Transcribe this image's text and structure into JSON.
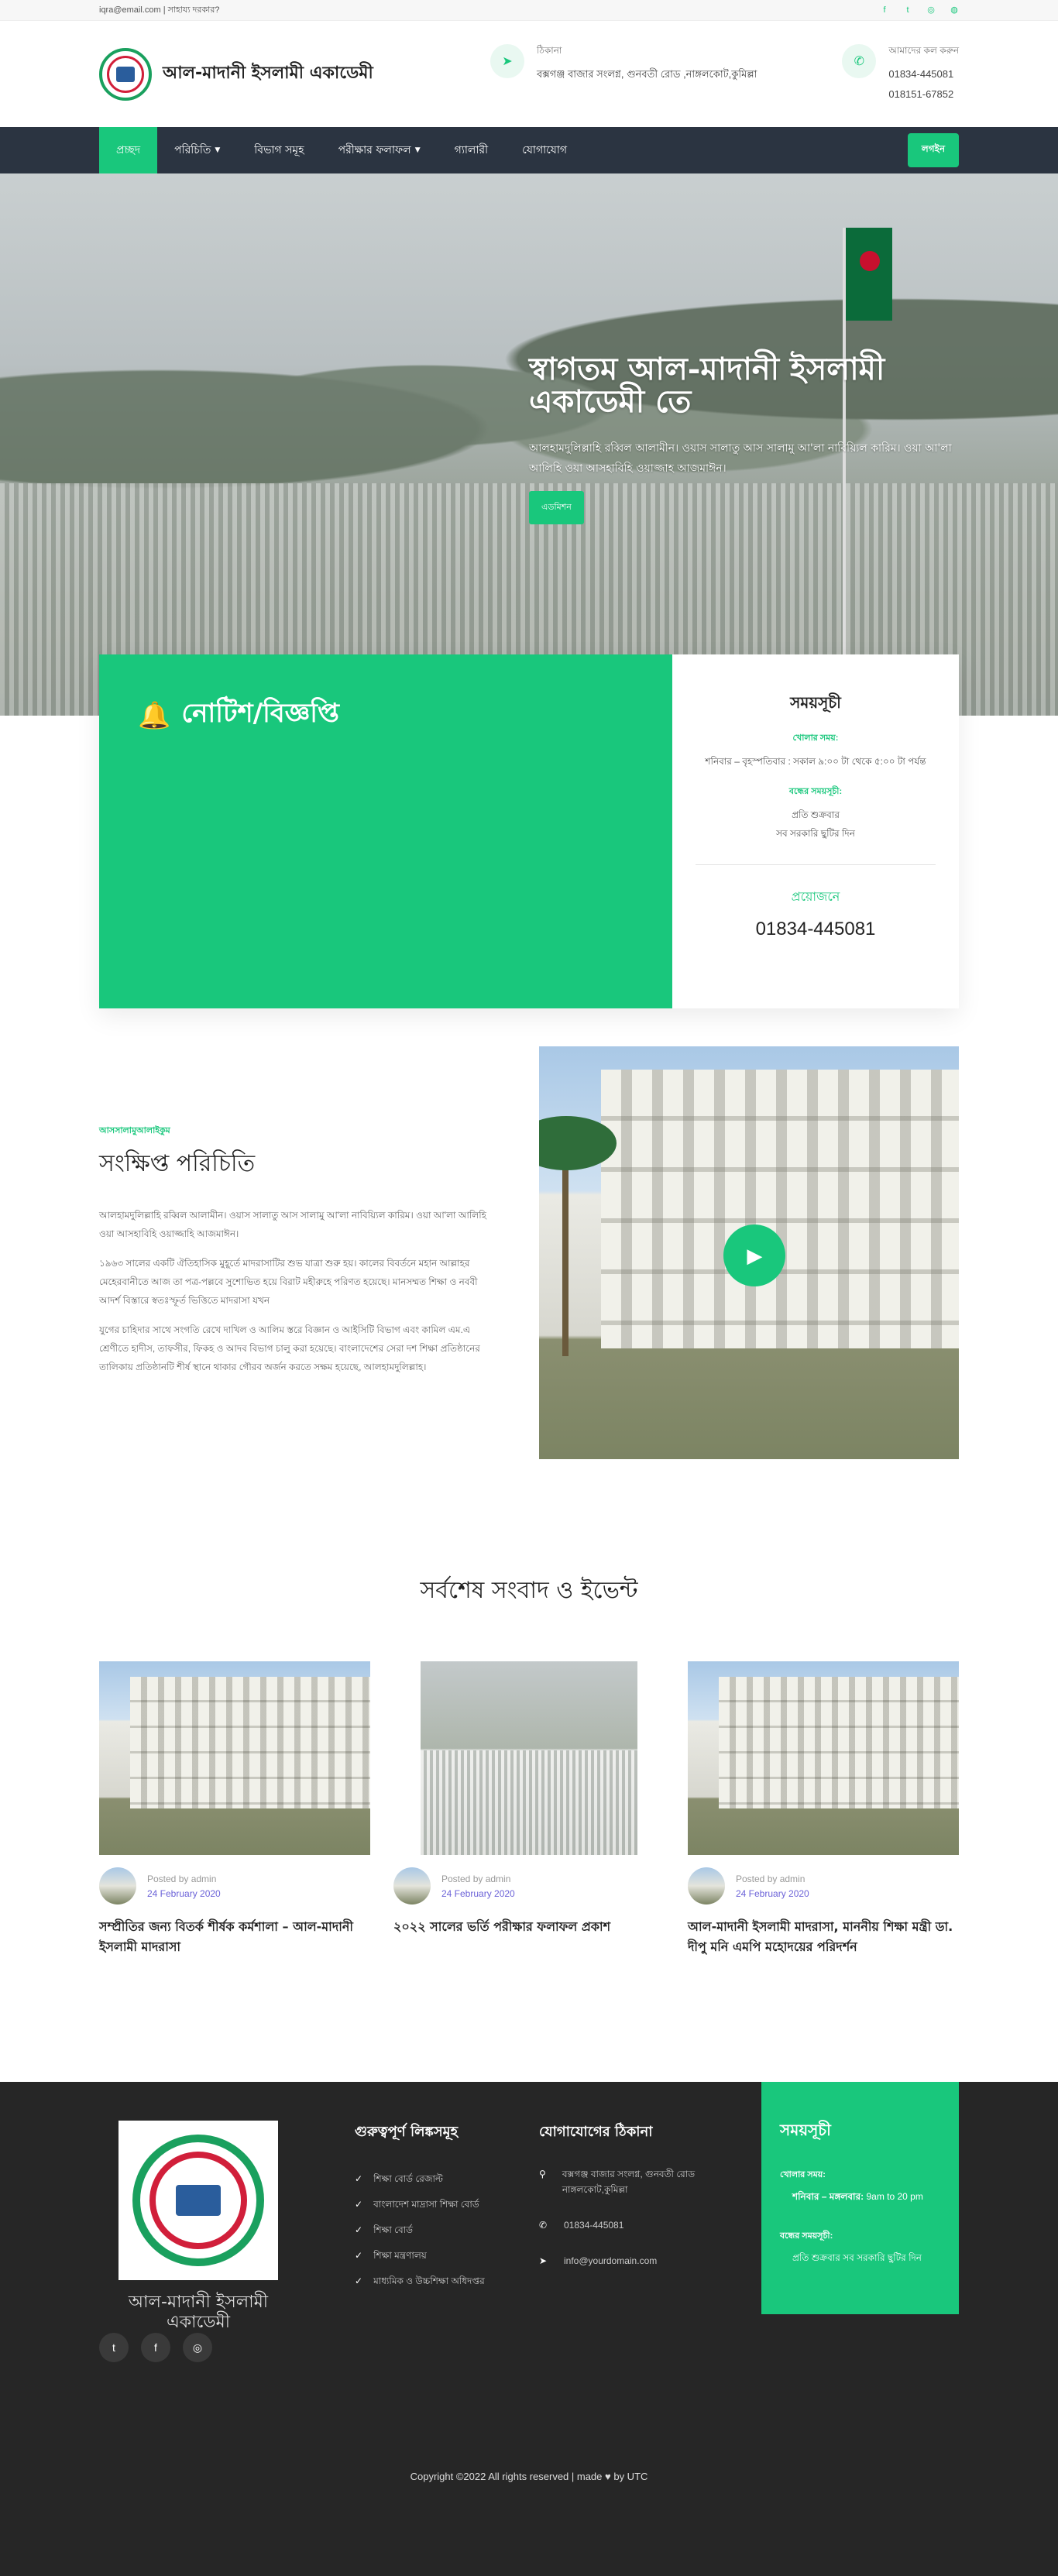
{
  "topbar": {
    "contact_text": "iqra@email.com | সাহায্য দরকার?",
    "social_icons": [
      "facebook-icon",
      "twitter-icon",
      "instagram-icon",
      "dribbble-icon"
    ]
  },
  "header": {
    "brand_name": "আল-মাদানী ইসলামী একাডেমী",
    "address_label": "ঠিকানা",
    "address_value": "বক্সগঞ্জ বাজার সংলগ্ন, গুনবতী রোড ,নাঙ্গলকোট,কুমিল্লা",
    "call_label": "আমাদের কল করুন",
    "call_value_1": "01834-445081",
    "call_value_2": "018151-67852"
  },
  "nav": {
    "items": [
      {
        "label": "প্রচ্ছদ",
        "active": true,
        "dropdown": false
      },
      {
        "label": "পরিচিতি",
        "active": false,
        "dropdown": true
      },
      {
        "label": "বিভাগ সমূহ",
        "active": false,
        "dropdown": false
      },
      {
        "label": "পরীক্ষার ফলাফল",
        "active": false,
        "dropdown": true
      },
      {
        "label": "গ্যালারী",
        "active": false,
        "dropdown": false
      },
      {
        "label": "যোগাযোগ",
        "active": false,
        "dropdown": false
      }
    ],
    "cta_label": "লগইন",
    "accent_color": "#19c77c",
    "bg_color": "#2b3441"
  },
  "hero": {
    "title": "স্বাগতম আল-মাদানী ইসলামী একাডেমী তে",
    "subtitle": "আলহামদুলিল্লাহি রব্বিল আলামীন। ওয়াস সালাতু আস সালামু আ'লা নাবিয়্যিল কারিম। ওয়া আ'লা আলিহি ওয়া আসহাবিহি ওয়াজ্জাহ আজমাঈন।",
    "button_label": "এডমিশন"
  },
  "notice": {
    "title": "নোটিশ/বিজ্ঞপ্তি",
    "icon": "bell-icon"
  },
  "schedule": {
    "title": "সময়সূচী",
    "open_label": "খোলার সময়:",
    "open_value": "শনিবার – বৃহস্পতিবার : সকাল ৯:০০ টা থেকে ৫:০০ টা পর্যন্ত",
    "closed_label": "বন্ধের সময়সূচী:",
    "closed_value_1": "প্রতি শুক্রবার",
    "closed_value_2": "সব সরকারি ছুটির দিন",
    "need_label": "প্রয়োজনে",
    "phone": "01834-445081"
  },
  "about": {
    "kicker": "আসসালামুআলাইকুম",
    "title": "সংক্ষিপ্ত পরিচিতি",
    "paragraphs": [
      "আলহামদুলিল্লাহি রব্বিল আলামীন। ওয়াস সালাতু আস সালামু আ'লা নাবিয়্যিল কারিম। ওয়া আ'লা আলিহি ওয়া আসহাবিহি ওয়াজ্জাহি আজমাঈন।",
      "১৯৬৩ সালের একটি ঐতিহাসিক মুহূর্তে মাদরাসাটির শুভ যাত্রা শুরু হয়। কালের বিবর্তনে মহান আল্লাহর মেহেরবানীতে আজ তা পত্র-পল্লবে সুশোভিত হয়ে বিরাট মহীরুহে পরিণত হয়েছে। মানসম্মত শিক্ষা ও নববী আদর্শ বিস্তারে স্বতঃস্ফূর্ত ভিত্তিতে মাদরাসা যখন",
      "যুগের চাহিদার সাথে সংগতি রেখে দাখিল ও আলিম স্তরে বিজ্ঞান ও আইসিটি বিভাগ এবং কামিল এম.এ শ্রেণীতে হাদীস, তাফসীর, ফিকহ ও আদব বিভাগ চালু করা হয়েছে। বাংলাদেশের সেরা দশ শিক্ষা প্রতিষ্ঠানের তালিকায় প্রতিষ্ঠানটি শীর্ষ স্থানে থাকার গৌরব অর্জন করতে সক্ষম হয়েছে, আলহামদুলিল্লাহ।"
    ],
    "play_icon": "play-icon"
  },
  "news": {
    "title": "সর্বশেষ সংবাদ ও ইভেন্ট",
    "cards": [
      {
        "posted_by": "Posted by admin",
        "date": "24 February 2020",
        "title": "সম্প্রীতির জন্য বিতর্ক শীর্ষক কর্মশালা – আল-মাদানী ইসলামী মাদরাসা"
      },
      {
        "posted_by": "Posted by admin",
        "date": "24 February 2020",
        "title": "২০২২ সালের ভর্তি পরীক্ষার ফলাফল প্রকাশ"
      },
      {
        "posted_by": "Posted by admin",
        "date": "24 February 2020",
        "title": "আল-মাদানী ইসলামী মাদরাসা, মাননীয় শিক্ষা মন্ত্রী ডা. দীপু মনি এমপি মহোদয়ের পরিদর্শন"
      }
    ]
  },
  "footer": {
    "name": "আল-মাদানী ইসলামী একাডেমী",
    "links_title": "গুরুত্বপূর্ণ লিঙ্কসমূহ",
    "links": [
      "শিক্ষা বোর্ড রেজাল্ট",
      "বাংলাদেশ মাদ্রাসা শিক্ষা বোর্ড",
      "শিক্ষা বোর্ড",
      "শিক্ষা মন্ত্রণালয়",
      "মাধ্যমিক ও উচ্চশিক্ষা অধিদপ্তর"
    ],
    "contact_title": "যোগাযোগের ঠিকানা",
    "address": "বক্সগঞ্জ বাজার সংলগ্ন, গুনবতী রোড নাঙ্গলকোট,কুমিল্লা",
    "phone": "01834-445081",
    "email": "info@yourdomain.com",
    "schedule_title": "সময়সূচী",
    "schedule_open_label": "খোলার সময়:",
    "schedule_open_value_a": "শনিবার – মঙ্গলবার:",
    "schedule_open_value_b": "9am to 20 pm",
    "schedule_closed_label": "বন্ধের সময়সূচী:",
    "schedule_closed_value": "প্রতি শুক্রবার সব সরকারি ছুটির দিন",
    "social_icons": [
      "twitter-icon",
      "facebook-icon",
      "instagram-icon"
    ],
    "copyright": "Copyright ©2022 All rights reserved | made ♥ by UTC"
  }
}
